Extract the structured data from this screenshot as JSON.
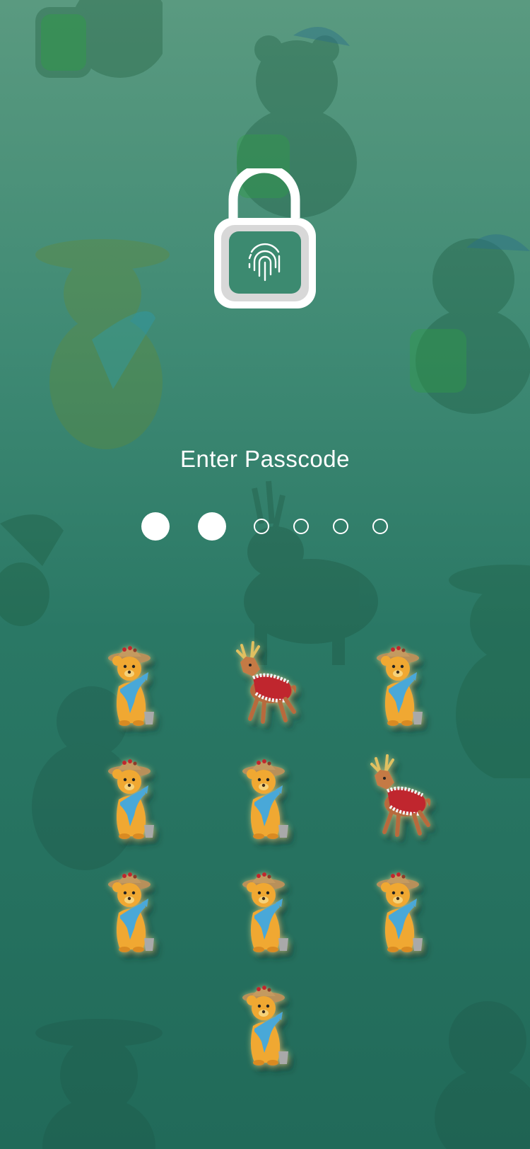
{
  "passcode": {
    "title": "Enter Passcode",
    "dots": [
      {
        "state": "filled"
      },
      {
        "state": "filled"
      },
      {
        "state": "empty"
      },
      {
        "state": "empty"
      },
      {
        "state": "empty"
      },
      {
        "state": "empty"
      }
    ],
    "keys": [
      {
        "character": "bear-with-fish"
      },
      {
        "character": "reindeer-with-cape"
      },
      {
        "character": "bear-with-fish"
      },
      {
        "character": "bear-with-fish"
      },
      {
        "character": "bear-with-fish"
      },
      {
        "character": "reindeer-with-cape"
      },
      {
        "character": "bear-with-fish"
      },
      {
        "character": "bear-with-fish"
      },
      {
        "character": "bear-with-fish"
      },
      {
        "character": "bear-with-fish"
      }
    ]
  },
  "colors": {
    "background_top": "#5a9a80",
    "background_bottom": "#216a59",
    "text": "#ffffff",
    "bear_fur": "#f0a830",
    "fish": "#4aa8d8",
    "reindeer_cape": "#c0272d"
  },
  "icons": {
    "lock": "unlocked-padlock-icon",
    "fingerprint": "fingerprint-icon"
  }
}
